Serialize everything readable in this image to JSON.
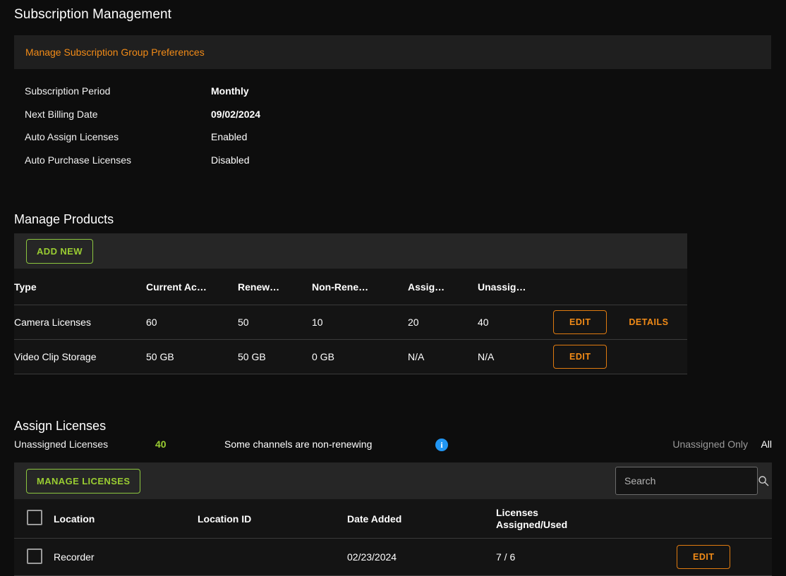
{
  "page_title": "Subscription Management",
  "prefs_banner": {
    "link_label": "Manage Subscription Group Preferences"
  },
  "summary": {
    "rows": [
      {
        "label": "Subscription Period",
        "value": "Monthly",
        "bold": true
      },
      {
        "label": "Next Billing Date",
        "value": "09/02/2024",
        "bold": true
      },
      {
        "label": "Auto Assign Licenses",
        "value": "Enabled",
        "bold": false
      },
      {
        "label": "Auto Purchase Licenses",
        "value": "Disabled",
        "bold": false
      }
    ]
  },
  "manage_products": {
    "title": "Manage Products",
    "add_new_label": "ADD NEW",
    "columns": [
      "Type",
      "Current Ac…",
      "Renew…",
      "Non-Rene…",
      "Assig…",
      "Unassig…"
    ],
    "rows": [
      {
        "type": "Camera Licenses",
        "current": "60",
        "renewing": "50",
        "non_renewing": "10",
        "assigned": "20",
        "unassigned": "40",
        "edit_label": "EDIT",
        "details_label": "DETAILS"
      },
      {
        "type": "Video Clip Storage",
        "current": "50 GB",
        "renewing": "50 GB",
        "non_renewing": "0 GB",
        "assigned": "N/A",
        "unassigned": "N/A",
        "edit_label": "EDIT",
        "details_label": ""
      }
    ]
  },
  "assign_licenses": {
    "title": "Assign Licenses",
    "unassigned_label": "Unassigned Licenses",
    "unassigned_count": "40",
    "non_renewing_note": "Some channels are non-renewing",
    "info_icon_glyph": "i",
    "filter_unassigned_label": "Unassigned Only",
    "filter_all_label": "All",
    "manage_licenses_label": "MANAGE LICENSES",
    "search": {
      "placeholder": "Search",
      "value": "",
      "icon": "search-icon"
    },
    "columns": {
      "location": "Location",
      "location_id": "Location ID",
      "date_added": "Date Added",
      "licenses_line1": "Licenses",
      "licenses_line2": "Assigned/Used"
    },
    "rows": [
      {
        "location": "Recorder",
        "location_id": "",
        "date_added": "02/23/2024",
        "licenses": "7 / 6",
        "edit_label": "EDIT"
      }
    ]
  },
  "colors": {
    "page_bg": "#0d0d0d",
    "panel_bg": "#141414",
    "band_bg": "#262626",
    "accent_orange": "#f28b17",
    "accent_green": "#9acd32",
    "info_blue": "#2196f3",
    "divider": "#3a3a3a"
  }
}
